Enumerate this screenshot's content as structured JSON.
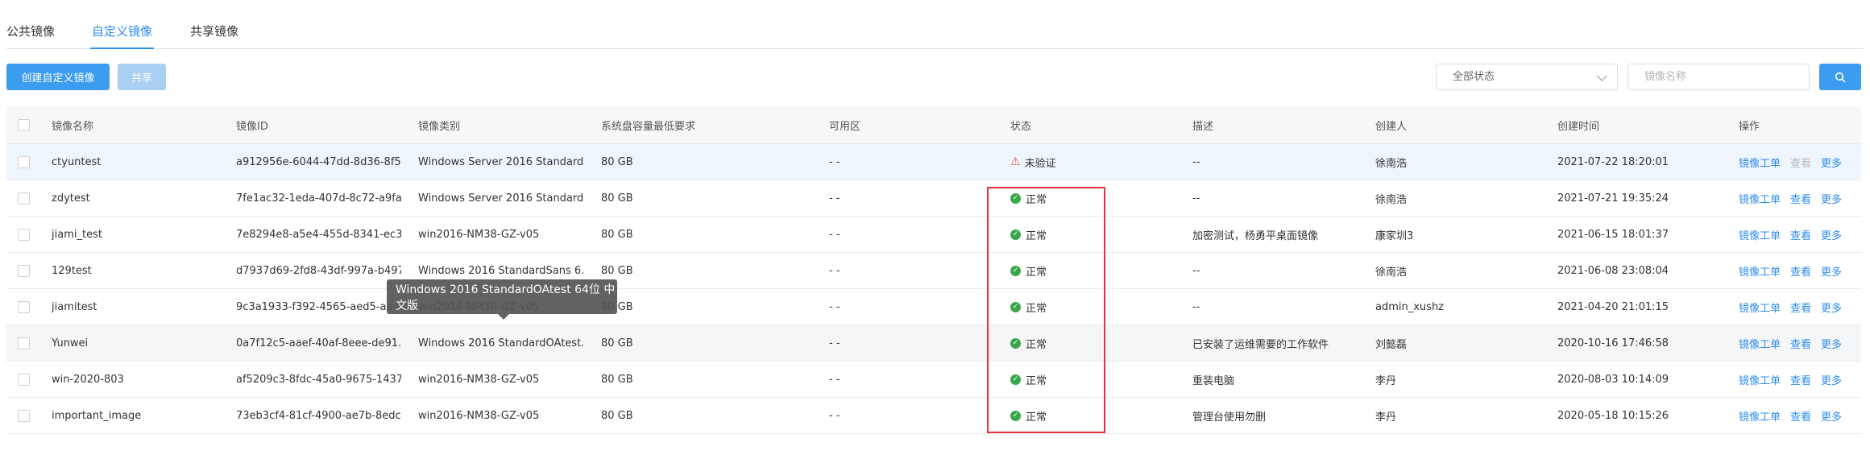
{
  "tabs": [
    "公共镜像",
    "自定义镜像",
    "共享镜像"
  ],
  "toolbar": {
    "create_label": "创建自定义镜像",
    "share_label": "共享",
    "status_select": "全部状态",
    "name_placeholder": "镜像名称"
  },
  "table": {
    "headers": [
      "镜像名称",
      "镜像ID",
      "镜像类别",
      "系统盘容量最低要求",
      "可用区",
      "状态",
      "描述",
      "创建人",
      "创建时间",
      "操作"
    ],
    "rows": [
      {
        "name": "ctyuntest",
        "id": "a912956e-6044-47dd-8d36-8f5...",
        "category": "Windows Server 2016 Standard",
        "disk": "80 GB",
        "zone": "- -",
        "status": "未验证",
        "status_type": "warn",
        "desc": "--",
        "creator": "徐南浩",
        "created": "2021-07-22 18:20:01",
        "actions": [
          "镜像工单",
          "查看",
          "更多"
        ],
        "view_disabled": true
      },
      {
        "name": "zdytest",
        "id": "7fe1ac32-1eda-407d-8c72-a9fa...",
        "category": "Windows Server 2016 Standard",
        "disk": "80 GB",
        "zone": "- -",
        "status": "正常",
        "status_type": "ok",
        "desc": "--",
        "creator": "徐南浩",
        "created": "2021-07-21 19:35:24",
        "actions": [
          "镜像工单",
          "查看",
          "更多"
        ],
        "view_disabled": false
      },
      {
        "name": "jiami_test",
        "id": "7e8294e8-a5e4-455d-8341-ec3...",
        "category": "win2016-NM38-GZ-v05",
        "disk": "80 GB",
        "zone": "- -",
        "status": "正常",
        "status_type": "ok",
        "desc": "加密测试，杨勇平桌面镜像",
        "creator": "康家圳3",
        "created": "2021-06-15 18:01:37",
        "actions": [
          "镜像工单",
          "查看",
          "更多"
        ],
        "view_disabled": false
      },
      {
        "name": "129test",
        "id": "d7937d69-2fd8-43df-997a-b497...",
        "category": "Windows 2016 StandardSans 6...",
        "disk": "80 GB",
        "zone": "- -",
        "status": "正常",
        "status_type": "ok",
        "desc": "--",
        "creator": "徐南浩",
        "created": "2021-06-08 23:08:04",
        "actions": [
          "镜像工单",
          "查看",
          "更多"
        ],
        "view_disabled": false
      },
      {
        "name": "jiamitest",
        "id": "9c3a1933-f392-4565-aed5-aa4...",
        "category": "win2016-NM38-GZ-v05",
        "disk": "80 GB",
        "zone": "- -",
        "status": "正常",
        "status_type": "ok",
        "desc": "--",
        "creator": "admin_xushz",
        "created": "2021-04-20 21:01:15",
        "actions": [
          "镜像工单",
          "查看",
          "更多"
        ],
        "view_disabled": false
      },
      {
        "name": "Yunwei",
        "id": "0a7f12c5-aaef-40af-8eee-de91...",
        "category": "Windows 2016 StandardOAtest...",
        "disk": "80 GB",
        "zone": "- -",
        "status": "正常",
        "status_type": "ok",
        "desc": "已安装了运维需要的工作软件",
        "creator": "刘懿磊",
        "created": "2020-10-16 17:46:58",
        "actions": [
          "镜像工单",
          "查看",
          "更多"
        ],
        "view_disabled": false
      },
      {
        "name": "win-2020-803",
        "id": "af5209c3-8fdc-45a0-9675-1437...",
        "category": "win2016-NM38-GZ-v05",
        "disk": "80 GB",
        "zone": "- -",
        "status": "正常",
        "status_type": "ok",
        "desc": "重装电脑",
        "creator": "李丹",
        "created": "2020-08-03 10:14:09",
        "actions": [
          "镜像工单",
          "查看",
          "更多"
        ],
        "view_disabled": false
      },
      {
        "name": "important_image",
        "id": "73eb3cf4-81cf-4900-ae7b-8edc...",
        "category": "win2016-NM38-GZ-v05",
        "disk": "80 GB",
        "zone": "- -",
        "status": "正常",
        "status_type": "ok",
        "desc": "管理台使用勿删",
        "creator": "李丹",
        "created": "2020-05-18 10:15:26",
        "actions": [
          "镜像工单",
          "查看",
          "更多"
        ],
        "view_disabled": false
      }
    ]
  },
  "tooltip": "Windows 2016 StandardOAtest 64位 中文版"
}
